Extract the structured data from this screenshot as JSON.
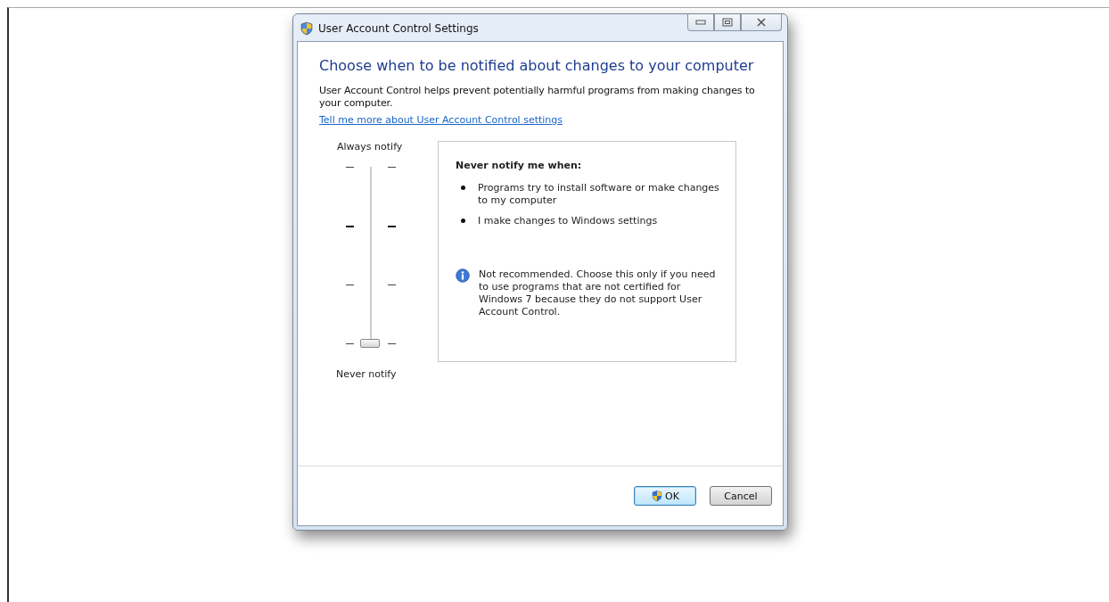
{
  "window": {
    "title": "User Account Control Settings"
  },
  "heading": "Choose when to be notified about changes to your computer",
  "description": "User Account Control helps prevent potentially harmful programs from making changes to your computer.",
  "link": "Tell me more about User Account Control settings",
  "slider": {
    "top_label": "Always notify",
    "bottom_label": "Never notify",
    "level": 0
  },
  "info_box": {
    "title": "Never notify me when:",
    "bullets": [
      "Programs try to install software or make changes to my computer",
      "I make changes to Windows settings"
    ],
    "note": "Not recommended. Choose this only if you need to use programs that are not certified for Windows 7 because they do not support User Account Control."
  },
  "buttons": [
    {
      "label": "OK",
      "kind": "shield",
      "default": true
    },
    {
      "label": "Cancel",
      "kind": "plain",
      "default": false
    }
  ]
}
